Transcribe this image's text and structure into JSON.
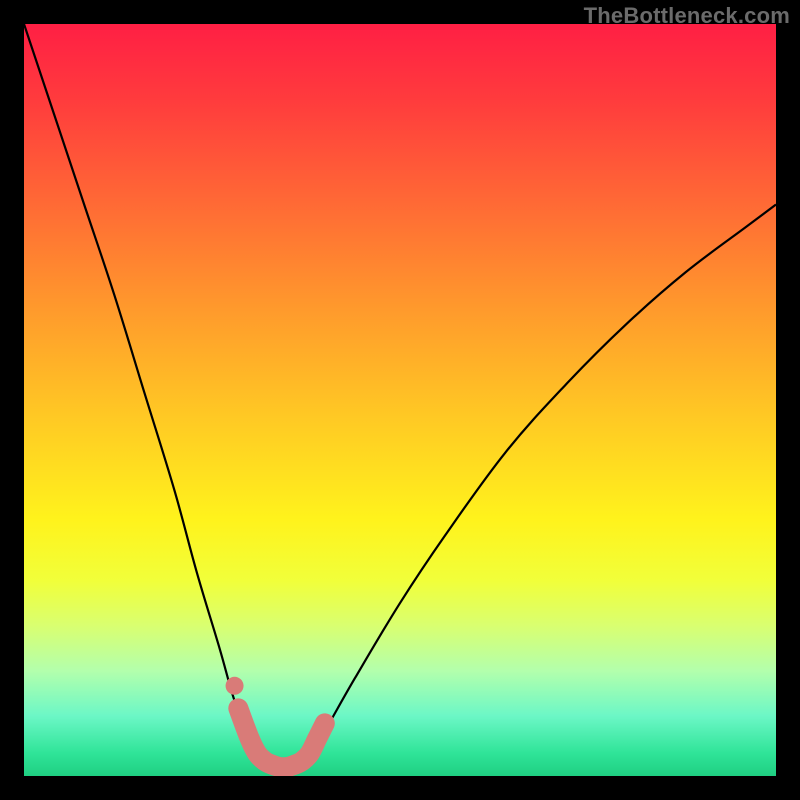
{
  "watermark": {
    "text": "TheBottleneck.com"
  },
  "chart_data": {
    "type": "line",
    "title": "",
    "xlabel": "",
    "ylabel": "",
    "xlim": [
      0,
      100
    ],
    "ylim": [
      0,
      100
    ],
    "grid": false,
    "series": [
      {
        "name": "bottleneck-curve",
        "x": [
          0,
          4,
          8,
          12,
          16,
          20,
          23,
          26,
          28,
          30,
          31,
          32,
          33,
          34,
          35,
          36,
          37,
          38,
          40,
          44,
          50,
          56,
          64,
          72,
          80,
          88,
          96,
          100
        ],
        "values": [
          100,
          88,
          76,
          64,
          51,
          38,
          27,
          17,
          10,
          5,
          3,
          2,
          1.5,
          1.2,
          1.2,
          1.5,
          2,
          3,
          6,
          13,
          23,
          32,
          43,
          52,
          60,
          67,
          73,
          76
        ]
      }
    ],
    "highlight": {
      "name": "sweet-spot-band",
      "color": "#d97b78",
      "points": [
        {
          "x": 28.5,
          "y": 9
        },
        {
          "x": 30.0,
          "y": 5
        },
        {
          "x": 31.0,
          "y": 3
        },
        {
          "x": 32.0,
          "y": 2
        },
        {
          "x": 33.0,
          "y": 1.5
        },
        {
          "x": 34.0,
          "y": 1.2
        },
        {
          "x": 35.0,
          "y": 1.2
        },
        {
          "x": 36.0,
          "y": 1.5
        },
        {
          "x": 37.0,
          "y": 2
        },
        {
          "x": 38.0,
          "y": 3
        },
        {
          "x": 39.0,
          "y": 5
        },
        {
          "x": 40.0,
          "y": 7
        }
      ],
      "dot": {
        "x": 28,
        "y": 12
      }
    }
  }
}
